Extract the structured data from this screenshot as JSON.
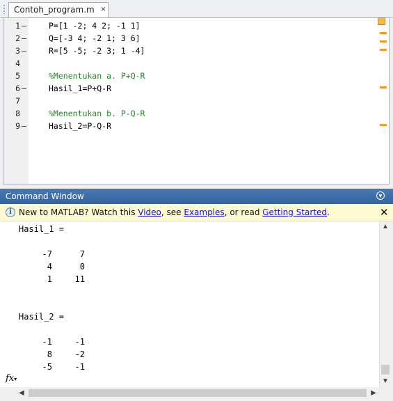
{
  "editor": {
    "tab_title": "Contoh_program.m",
    "tab_close": "×",
    "lines": [
      {
        "num": "1",
        "bp": "–",
        "code": "P=[1 -2; 4 2; -1 1]",
        "comment": false
      },
      {
        "num": "2",
        "bp": "–",
        "code": "Q=[-3 4; -2 1; 3 6]",
        "comment": false
      },
      {
        "num": "3",
        "bp": "–",
        "code": "R=[5 -5; -2 3; 1 -4]",
        "comment": false
      },
      {
        "num": "4",
        "bp": "",
        "code": "",
        "comment": false
      },
      {
        "num": "5",
        "bp": "",
        "code": "%Menentukan a. P+Q-R",
        "comment": true
      },
      {
        "num": "6",
        "bp": "–",
        "code": "Hasil_1=P+Q-R",
        "comment": false
      },
      {
        "num": "7",
        "bp": "",
        "code": "",
        "comment": false
      },
      {
        "num": "8",
        "bp": "",
        "code": "%Menentukan b. P-Q-R",
        "comment": true
      },
      {
        "num": "9",
        "bp": "–",
        "code": "Hasil_2=P-Q-R",
        "comment": false
      }
    ],
    "colors": {
      "comment": "#228b22",
      "warning_marker": "#f59a23"
    }
  },
  "command_window": {
    "title": "Command Window",
    "menu_icon": "▼",
    "notice": {
      "prefix": "New to MATLAB? Watch this ",
      "video_link": "Video",
      "mid1": ", see ",
      "examples_link": "Examples",
      "mid2": ", or read ",
      "getting_started_link": "Getting Started",
      "suffix": ".",
      "close": "✕",
      "info_icon": "i"
    },
    "output": {
      "hasil1_label": "Hasil_1 =",
      "hasil1_rows": [
        [
          "-7",
          "7"
        ],
        [
          "4",
          "0"
        ],
        [
          "1",
          "11"
        ]
      ],
      "hasil2_label": "Hasil_2 =",
      "hasil2_rows": [
        [
          "-1",
          "-1"
        ],
        [
          "8",
          "-2"
        ],
        [
          "-5",
          "-1"
        ]
      ]
    },
    "prompt_icon": "fx"
  }
}
